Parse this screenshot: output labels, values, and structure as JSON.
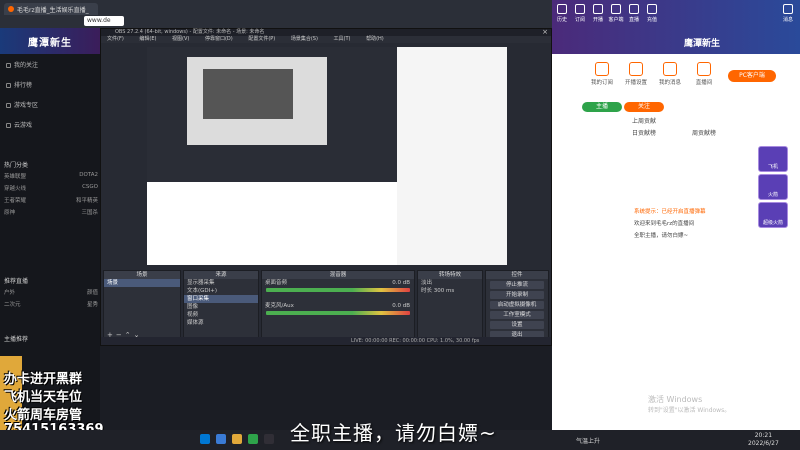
{
  "browser": {
    "tab_title": "毛毛rz直播_生活娱乐直播_",
    "url_fragment": "www.de"
  },
  "left_sidebar": {
    "banner": "鹰潭新生",
    "items": [
      "我的关注",
      "排行榜",
      "游戏专区",
      "云游戏"
    ],
    "section_hot": "热门分类",
    "section_stream": "推荐直播",
    "section_anchor": "主播推荐",
    "channels": [
      [
        "英雄联盟",
        "DOTA2"
      ],
      [
        "穿越火线",
        "CSGO"
      ],
      [
        "王者荣耀",
        "和平精英"
      ],
      [
        "原神",
        "三国杀"
      ],
      [
        "户外",
        "颜值"
      ],
      [
        "二次元",
        "星秀"
      ]
    ]
  },
  "obs": {
    "title": "OBS 27.2.4 (64-bit, windows) - 配置文件: 未命名 - 场景: 未命名",
    "menu": [
      "文件(F)",
      "编辑(E)",
      "视图(V)",
      "停靠窗口(D)",
      "配置文件(P)",
      "场景集合(S)",
      "工具(T)",
      "帮助(H)"
    ],
    "preview_subtitle": "全职主播，请勿白嫖~",
    "scenes": {
      "header": "场景",
      "items": [
        "场景"
      ]
    },
    "sources": {
      "header": "来源",
      "items": [
        "显示器采集",
        "文本(GDI+)",
        "窗口采集",
        "图像",
        "视频",
        "媒体源"
      ]
    },
    "mixer": {
      "header": "混音器",
      "channels": [
        {
          "name": "桌面音频",
          "db": "0.0 dB"
        },
        {
          "name": "麦克风/Aux",
          "db": "0.0 dB"
        }
      ]
    },
    "transitions": {
      "header": "转场特效",
      "fade": "淡出",
      "duration_label": "时长",
      "duration_value": "300 ms"
    },
    "controls": {
      "header": "控件",
      "buttons": [
        "停止推流",
        "开始录制",
        "启动虚拟摄像机",
        "工作室模式",
        "设置",
        "退出"
      ]
    },
    "status": "LIVE: 00:00:00   REC: 00:00:00   CPU: 1.0%, 30.00 fps"
  },
  "right_panel": {
    "banner": "鹰潭新生",
    "nav": [
      "历史",
      "订阅",
      "开播",
      "客户端",
      "直播",
      "充值",
      "消息"
    ],
    "user_buttons": [
      "我的订阅",
      "开播设置",
      "我的消息",
      "直播间"
    ],
    "pc_button": "PC客户端",
    "btn_green": "主播",
    "btn_orange": "关注",
    "tabs": [
      "上周贡献",
      "日贡献榜",
      "周贡献榜"
    ],
    "chat": [
      "系统提示：已经开启直播弹幕",
      "欢迎来到毛毛rz的直播间",
      "全职主播，请勿白嫖~"
    ],
    "gifts": [
      "飞机",
      "火箭",
      "超级火箭"
    ],
    "activate_title": "激活 Windows",
    "activate_sub": "转到\"设置\"以激活 Windows。"
  },
  "overlay": {
    "lines": [
      "办卡进开黑群",
      "飞机当天车位",
      "火箭周车房管",
      "75415163369"
    ]
  },
  "taskbar": {
    "subtitle": "全职主播，请勿白嫖~",
    "weather": "气温上升",
    "time": "20:21",
    "date": "2022/6/27"
  }
}
